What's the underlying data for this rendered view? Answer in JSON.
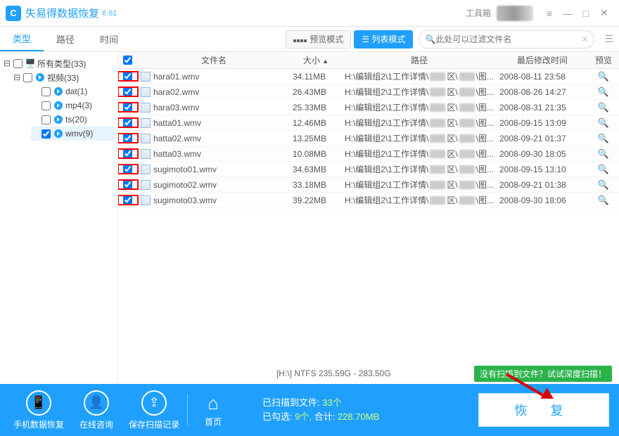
{
  "app": {
    "title": "失易得数据恢复",
    "version": "6.81",
    "logo_letter": "C"
  },
  "titlebar": {
    "toolbox": "工具箱"
  },
  "tabs": {
    "items": [
      "类型",
      "路径",
      "时间"
    ],
    "active": 0
  },
  "view": {
    "preview": "预览模式",
    "list": "列表模式"
  },
  "search": {
    "placeholder": "此处可以过滤文件名"
  },
  "tree": {
    "root": {
      "label": "所有类型(33)"
    },
    "video": {
      "label": "视频(33)"
    },
    "children": [
      {
        "label": "dat(1)"
      },
      {
        "label": "mp4(3)"
      },
      {
        "label": "ts(20)"
      },
      {
        "label": "wmv(9)",
        "selected": true
      }
    ]
  },
  "columns": {
    "name": "文件名",
    "size": "大小",
    "path": "路径",
    "date": "最后修改时间",
    "preview": "预览"
  },
  "path_prefix": "H:\\编辑组2\\1工作详情\\",
  "path_suffix_a": "区\\",
  "path_suffix_b": "\\图...",
  "files": [
    {
      "name": "hara01.wmv",
      "size": "34.11MB",
      "date": "2008-08-11  23:58"
    },
    {
      "name": "hara02.wmv",
      "size": "26.43MB",
      "date": "2008-08-26  14:27"
    },
    {
      "name": "hara03.wmv",
      "size": "25.33MB",
      "date": "2008-08-31  21:35"
    },
    {
      "name": "hatta01.wmv",
      "size": "12.46MB",
      "date": "2008-09-15  13:09"
    },
    {
      "name": "hatta02.wmv",
      "size": "13.25MB",
      "date": "2008-09-21  01:37"
    },
    {
      "name": "hatta03.wmv",
      "size": "10.08MB",
      "date": "2008-09-30  18:05"
    },
    {
      "name": "sugimoto01.wmv",
      "size": "34.63MB",
      "date": "2008-09-15  13:10"
    },
    {
      "name": "sugimoto02.wmv",
      "size": "33.18MB",
      "date": "2008-09-21  01:38"
    },
    {
      "name": "sugimoto03.wmv",
      "size": "39.22MB",
      "date": "2008-09-30  18:06"
    }
  ],
  "disk": {
    "info": "[H:\\] NTFS 235.59G - 283.50G",
    "deep": "没有扫描到文件？试试深度扫描！"
  },
  "bottom": {
    "phone": "手机数据恢复",
    "online": "在线咨询",
    "save": "保存扫描记录",
    "home": "首页",
    "scanned_label": "已扫描到文件:",
    "scanned_value": "33个",
    "checked_label": "已勾选:",
    "checked_count": "9个,",
    "total_label": "合计:",
    "total_size": "228.70MB",
    "recover": "恢 复"
  }
}
